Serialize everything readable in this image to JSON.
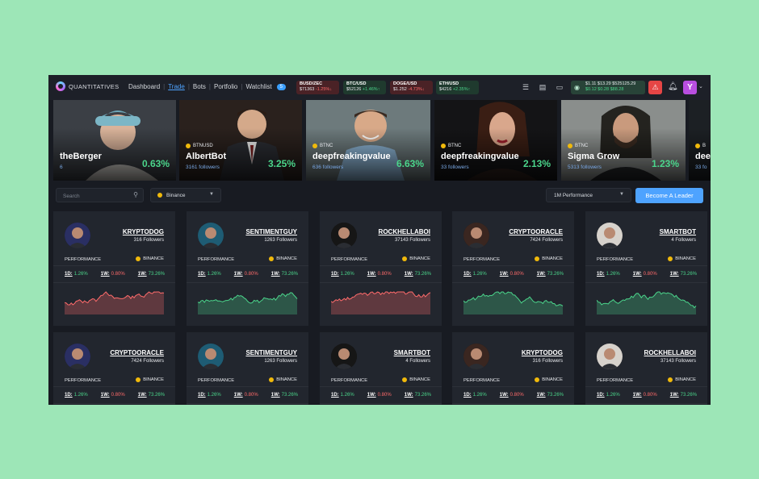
{
  "app": {
    "name": "QUANTITATIVES"
  },
  "nav": {
    "items": [
      "Dashboard",
      "Trade",
      "Bots",
      "Portfolio",
      "Watchlist"
    ],
    "active": "Trade",
    "watchlist_badge": "5"
  },
  "tickers": [
    {
      "pair": "BUSD/ZEC",
      "price": "$71363",
      "change": "-1.25%",
      "dir": "down"
    },
    {
      "pair": "BTC/USD",
      "price": "$52126",
      "change": "+1.46%",
      "dir": "up"
    },
    {
      "pair": "DOGE/USD",
      "price": "$1.252",
      "change": "-4.73%",
      "dir": "down"
    },
    {
      "pair": "ETH/USD",
      "price": "$4216",
      "change": "+2.35%",
      "dir": "up"
    }
  ],
  "wallet": {
    "line1": "$1.11  $13.29  $525125.29",
    "line2": "$0.12  $0.28     $88.28"
  },
  "hero": [
    {
      "ticker": "",
      "name": "theBerger",
      "followers": "6",
      "performance": "0.63%"
    },
    {
      "ticker": "BTNUSD",
      "name": "AlbertBot",
      "followers": "3161 followers",
      "performance": "3.25%"
    },
    {
      "ticker": "BTNC",
      "name": "deepfreakingvalue",
      "followers": "636 followers",
      "performance": "6.63%"
    },
    {
      "ticker": "BTNC",
      "name": "deepfreakingvalue",
      "followers": "33 followers",
      "performance": "2.13%"
    },
    {
      "ticker": "BTNC",
      "name": "Sigma Grow",
      "followers": "5313 followers",
      "performance": "1.23%"
    },
    {
      "ticker": "B",
      "name": "dee",
      "followers": "33 fo",
      "performance": ""
    }
  ],
  "filters": {
    "search_placeholder": "Search",
    "exchange": "Binance",
    "period": "1M Performance",
    "cta": "Become A Leader"
  },
  "card_labels": {
    "performance": "PERFORMANCE",
    "exchange": "BINANCE",
    "d1": "1D:",
    "w1": "1W:",
    "w3": "1W:"
  },
  "cards": [
    {
      "name": "KRYPTODOG",
      "followers": "316 Followers",
      "d1": "1.26%",
      "w1": "0.80%",
      "w3": "73.26%",
      "trend": "red"
    },
    {
      "name": "SENTIMENTGUY",
      "followers": "1263 Followers",
      "d1": "1.26%",
      "w1": "0.80%",
      "w3": "73.26%",
      "trend": "green"
    },
    {
      "name": "ROCKHELLABOI",
      "followers": "37143 Followers",
      "d1": "1.26%",
      "w1": "0.80%",
      "w3": "73.26%",
      "trend": "red"
    },
    {
      "name": "CRYPTOORACLE",
      "followers": "7424 Followers",
      "d1": "1.26%",
      "w1": "0.80%",
      "w3": "73.26%",
      "trend": "green"
    },
    {
      "name": "SMARTBOT",
      "followers": "4 Followers",
      "d1": "1.26%",
      "w1": "0.80%",
      "w3": "73.26%",
      "trend": "green"
    },
    {
      "name": "CRYPTOORACLE",
      "followers": "7424 Followers",
      "d1": "1.26%",
      "w1": "0.80%",
      "w3": "73.26%",
      "trend": ""
    },
    {
      "name": "SENTIMENTGUY",
      "followers": "1263 Followers",
      "d1": "1.26%",
      "w1": "0.80%",
      "w3": "73.26%",
      "trend": ""
    },
    {
      "name": "SMARTBOT",
      "followers": "4 Followers",
      "d1": "1.26%",
      "w1": "0.80%",
      "w3": "73.26%",
      "trend": ""
    },
    {
      "name": "KRYPTODOG",
      "followers": "316 Followers",
      "d1": "1.26%",
      "w1": "0.80%",
      "w3": "73.26%",
      "trend": ""
    },
    {
      "name": "ROCKHELLABOI",
      "followers": "37143 Followers",
      "d1": "1.26%",
      "w1": "0.80%",
      "w3": "73.26%",
      "trend": ""
    }
  ],
  "colors": {
    "accent": "#4ea3ff",
    "up": "#4bd58b",
    "down": "#ff6b6b",
    "background": "#181b22",
    "card": "#22262e"
  }
}
